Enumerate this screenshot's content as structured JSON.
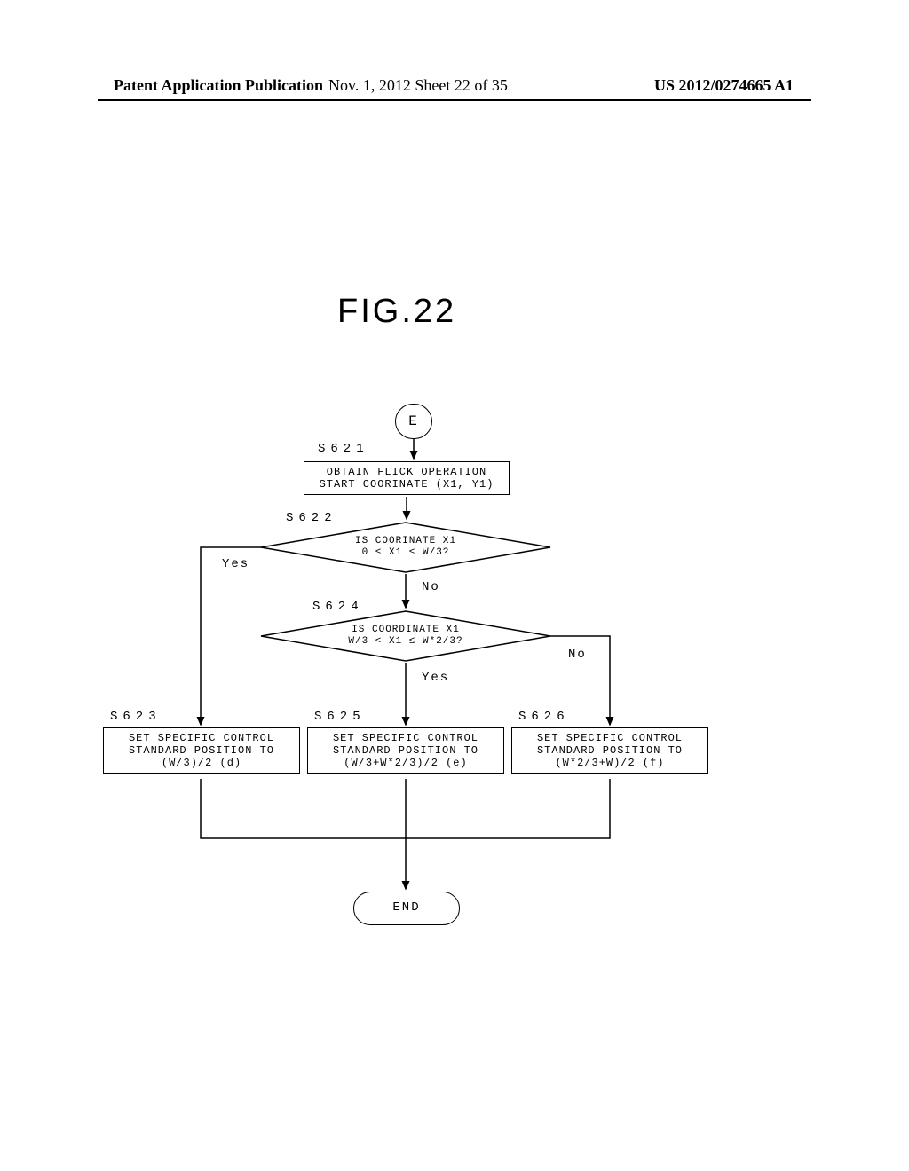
{
  "header": {
    "left": "Patent Application Publication",
    "center": "Nov. 1, 2012  Sheet 22 of 35",
    "right": "US 2012/0274665 A1"
  },
  "figure_title": "FIG.22",
  "terminators": {
    "start": "E",
    "end": "END"
  },
  "steps": {
    "s621": {
      "label": "S621",
      "text1": "OBTAIN FLICK OPERATION",
      "text2": "START COORINATE (X1, Y1)"
    },
    "s622": {
      "label": "S622",
      "text1": "IS COORINATE X1",
      "text2": "0 ≤ X1 ≤ W/3?"
    },
    "s623": {
      "label": "S623",
      "text1": "SET SPECIFIC CONTROL",
      "text2": "STANDARD POSITION TO",
      "text3": "(W/3)/2  (d)"
    },
    "s624": {
      "label": "S624",
      "text1": "IS COORDINATE X1",
      "text2": "W/3 < X1 ≤ W*2/3?"
    },
    "s625": {
      "label": "S625",
      "text1": "SET SPECIFIC CONTROL",
      "text2": "STANDARD POSITION TO",
      "text3": "(W/3+W*2/3)/2 (e)"
    },
    "s626": {
      "label": "S626",
      "text1": "SET SPECIFIC CONTROL",
      "text2": "STANDARD POSITION TO",
      "text3": "(W*2/3+W)/2 (f)"
    }
  },
  "labels": {
    "yes": "Yes",
    "no": "No"
  }
}
